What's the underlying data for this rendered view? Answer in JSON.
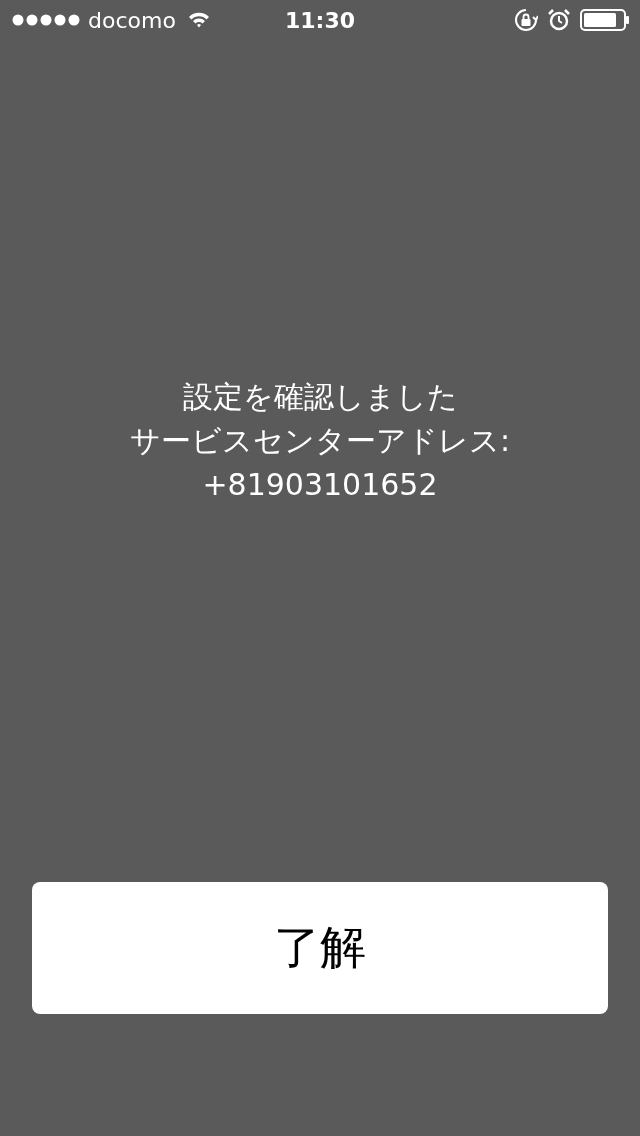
{
  "status_bar": {
    "carrier": "docomo",
    "time": "11:30"
  },
  "message": [
    "設定を確認しました",
    "サービスセンターアドレス:",
    "+81903101652"
  ],
  "button": {
    "label": "了解"
  }
}
